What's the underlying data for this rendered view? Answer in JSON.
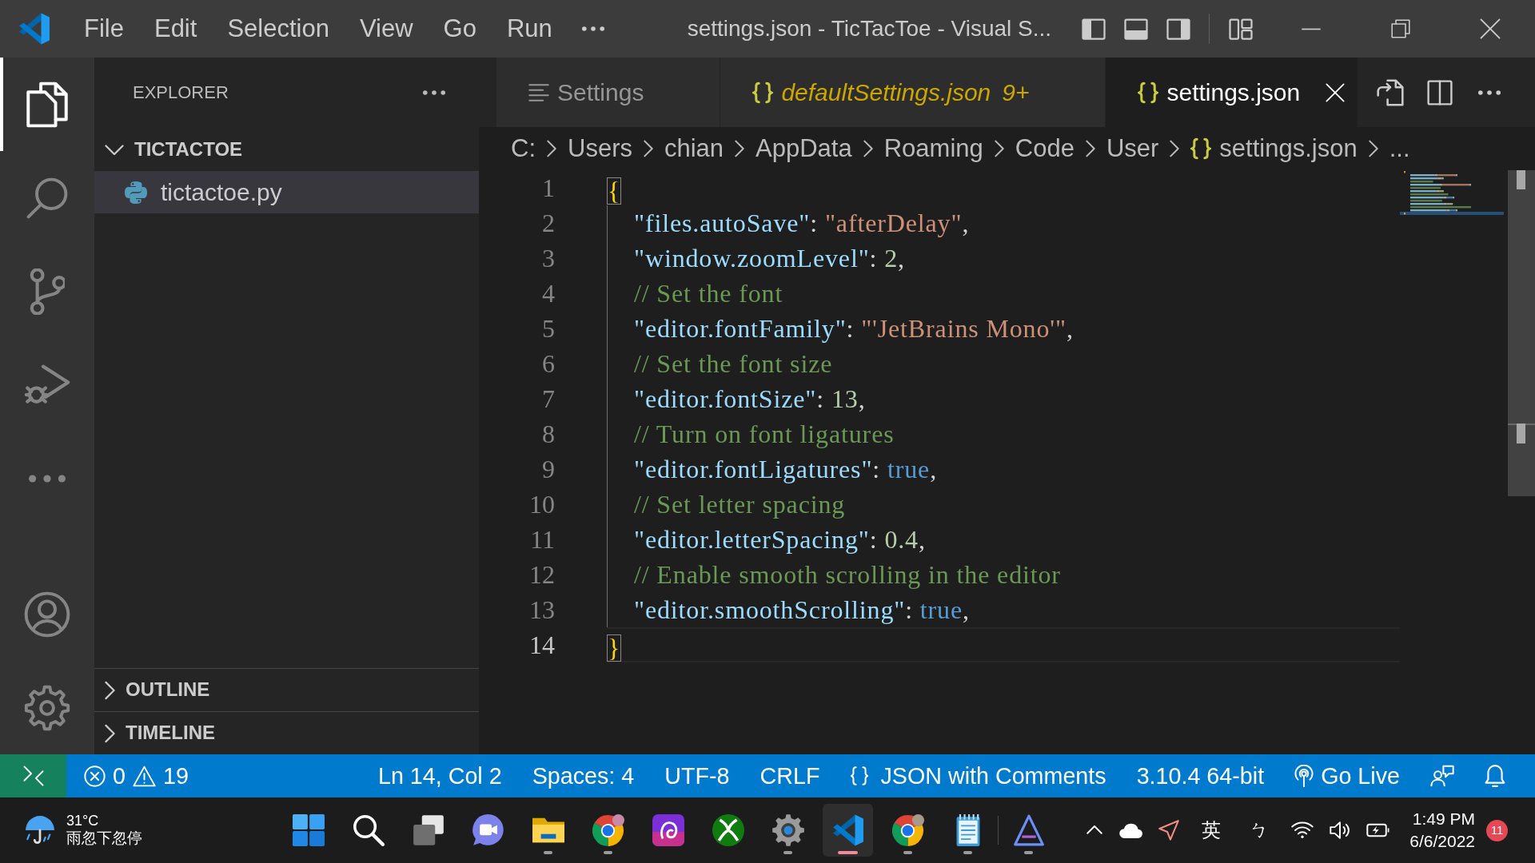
{
  "title_bar": {
    "menu": [
      "File",
      "Edit",
      "Selection",
      "View",
      "Go",
      "Run"
    ],
    "title": "settings.json - TicTacToe - Visual S..."
  },
  "activity_bar": {
    "top": [
      {
        "kind": "explorer",
        "selected": true
      },
      {
        "kind": "search",
        "selected": false
      },
      {
        "kind": "scm",
        "selected": false
      },
      {
        "kind": "debug",
        "selected": false
      },
      {
        "kind": "more",
        "selected": false
      }
    ],
    "bottom": [
      {
        "kind": "account",
        "selected": false
      },
      {
        "kind": "manage",
        "selected": false
      }
    ]
  },
  "sidebar": {
    "title": "EXPLORER",
    "folder": {
      "name": "TICTACTOE",
      "expanded": true,
      "children": [
        {
          "name": "tictactoe.py",
          "kind": "python",
          "selected": true
        }
      ]
    },
    "sections": [
      {
        "name": "OUTLINE",
        "expanded": false
      },
      {
        "name": "TIMELINE",
        "expanded": false
      }
    ]
  },
  "tabs": [
    {
      "label": "Settings",
      "kind": "settings",
      "selected": false,
      "preview": false
    },
    {
      "label": "defaultSettings.json",
      "kind": "json",
      "selected": false,
      "preview": true,
      "problems": "9+"
    },
    {
      "label": "settings.json",
      "kind": "json",
      "selected": true,
      "preview": false
    }
  ],
  "breadcrumb": [
    {
      "label": "C:",
      "kind": "folder"
    },
    {
      "label": "Users",
      "kind": "folder"
    },
    {
      "label": "chian",
      "kind": "folder"
    },
    {
      "label": "AppData",
      "kind": "folder"
    },
    {
      "label": "Roaming",
      "kind": "folder"
    },
    {
      "label": "Code",
      "kind": "folder"
    },
    {
      "label": "User",
      "kind": "folder"
    },
    {
      "label": "settings.json",
      "kind": "json"
    },
    {
      "label": "...",
      "kind": "symbol"
    }
  ],
  "editor": {
    "lines": [
      {
        "number": "1",
        "current": false,
        "tokens": [
          {
            "kind": "bracket",
            "text": "{",
            "matched": true
          }
        ],
        "children": [
          {
            "number": "2",
            "current": false,
            "tokens": [
              {
                "kind": "key",
                "text": "\"files.autoSave\""
              },
              {
                "kind": "punct",
                "text": ": "
              },
              {
                "kind": "string",
                "text": "\"afterDelay\""
              },
              {
                "kind": "punct",
                "text": ","
              }
            ]
          },
          {
            "number": "3",
            "current": false,
            "tokens": [
              {
                "kind": "key",
                "text": "\"window.zoomLevel\""
              },
              {
                "kind": "punct",
                "text": ": "
              },
              {
                "kind": "number",
                "text": "2"
              },
              {
                "kind": "punct",
                "text": ","
              }
            ]
          },
          {
            "number": "4",
            "current": false,
            "tokens": [
              {
                "kind": "comment",
                "text": "// Set the font"
              }
            ]
          },
          {
            "number": "5",
            "current": false,
            "tokens": [
              {
                "kind": "key",
                "text": "\"editor.fontFamily\""
              },
              {
                "kind": "punct",
                "text": ": "
              },
              {
                "kind": "string",
                "text": "\"'JetBrains Mono'\""
              },
              {
                "kind": "punct",
                "text": ","
              }
            ]
          },
          {
            "number": "6",
            "current": false,
            "tokens": [
              {
                "kind": "comment",
                "text": "// Set the font size"
              }
            ]
          },
          {
            "number": "7",
            "current": false,
            "tokens": [
              {
                "kind": "key",
                "text": "\"editor.fontSize\""
              },
              {
                "kind": "punct",
                "text": ": "
              },
              {
                "kind": "number",
                "text": "13"
              },
              {
                "kind": "punct",
                "text": ","
              }
            ]
          },
          {
            "number": "8",
            "current": false,
            "tokens": [
              {
                "kind": "comment",
                "text": "// Turn on font ligatures"
              }
            ]
          },
          {
            "number": "9",
            "current": false,
            "tokens": [
              {
                "kind": "key",
                "text": "\"editor.fontLigatures\""
              },
              {
                "kind": "punct",
                "text": ": "
              },
              {
                "kind": "keyword",
                "text": "true"
              },
              {
                "kind": "punct",
                "text": ","
              }
            ]
          },
          {
            "number": "10",
            "current": false,
            "tokens": [
              {
                "kind": "comment",
                "text": "// Set letter spacing"
              }
            ]
          },
          {
            "number": "11",
            "current": false,
            "tokens": [
              {
                "kind": "key",
                "text": "\"editor.letterSpacing\""
              },
              {
                "kind": "punct",
                "text": ": "
              },
              {
                "kind": "number",
                "text": "0.4"
              },
              {
                "kind": "punct",
                "text": ","
              }
            ]
          },
          {
            "number": "12",
            "current": false,
            "tokens": [
              {
                "kind": "comment",
                "text": "// Enable smooth scrolling in the editor"
              }
            ]
          },
          {
            "number": "13",
            "current": false,
            "tokens": [
              {
                "kind": "key",
                "text": "\"editor.smoothScrolling\""
              },
              {
                "kind": "punct",
                "text": ": "
              },
              {
                "kind": "keyword",
                "text": "true"
              },
              {
                "kind": "punct",
                "text": ","
              }
            ]
          }
        ]
      },
      {
        "number": "14",
        "current": true,
        "tokens": [
          {
            "kind": "bracket",
            "text": "}",
            "matched": true
          }
        ]
      }
    ]
  },
  "status_bar": {
    "left": [
      {
        "kind": "remote"
      },
      {
        "kind": "problems",
        "errors": "0",
        "warnings": "19"
      }
    ],
    "right": [
      {
        "kind": "position",
        "label": "Ln 14, Col 2"
      },
      {
        "kind": "indentation",
        "label": "Spaces: 4"
      },
      {
        "kind": "encoding",
        "label": "UTF-8"
      },
      {
        "kind": "eol",
        "label": "CRLF"
      },
      {
        "kind": "language",
        "label": "JSON with Comments"
      },
      {
        "kind": "interpreter",
        "label": "3.10.4 64-bit"
      },
      {
        "kind": "live",
        "label": "Go Live"
      },
      {
        "kind": "feedback"
      },
      {
        "kind": "notifications"
      }
    ]
  },
  "taskbar": {
    "weather": {
      "temperature": "31°C",
      "condition": "雨忽下忽停"
    },
    "app_groups": [
      [
        {
          "kind": "start",
          "running": false,
          "selected": false
        },
        {
          "kind": "search",
          "running": false,
          "selected": false
        },
        {
          "kind": "taskview",
          "running": false,
          "selected": false
        },
        {
          "kind": "chat",
          "running": false,
          "selected": false
        },
        {
          "kind": "files",
          "running": true,
          "selected": false
        },
        {
          "kind": "browser",
          "running": true,
          "selected": false
        },
        {
          "kind": "app",
          "running": false,
          "selected": false
        },
        {
          "kind": "game",
          "running": false,
          "selected": false
        },
        {
          "kind": "settings",
          "running": true,
          "selected": false
        },
        {
          "kind": "editor",
          "running": true,
          "selected": true
        },
        {
          "kind": "browser",
          "running": true,
          "selected": false
        },
        {
          "kind": "notes",
          "running": true,
          "selected": false
        }
      ],
      [
        {
          "kind": "designer",
          "running": true,
          "selected": false
        }
      ]
    ],
    "tray": [
      {
        "kind": "chevron"
      },
      {
        "kind": "cloud"
      },
      {
        "kind": "location"
      },
      {
        "kind": "ime",
        "label": "英"
      },
      {
        "kind": "ime",
        "label": "ㄅ"
      },
      {
        "kind": "wifi"
      },
      {
        "kind": "volume"
      },
      {
        "kind": "battery"
      }
    ],
    "time": "1:49 PM",
    "date": "6/6/2022",
    "notifications": "11"
  }
}
